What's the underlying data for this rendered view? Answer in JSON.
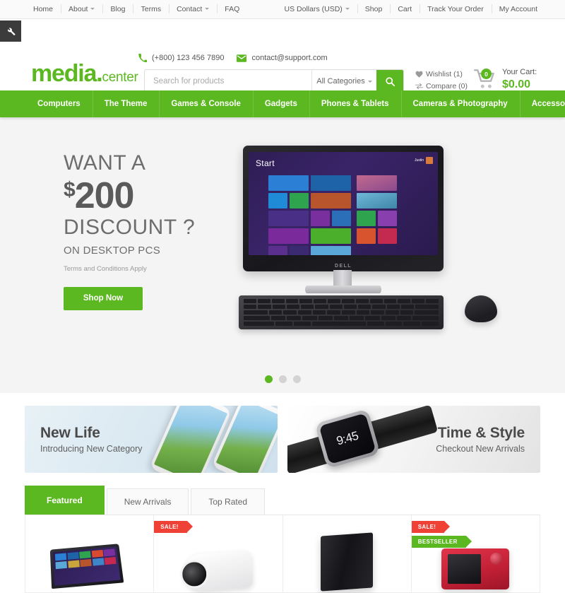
{
  "topbar": {
    "left_links": [
      {
        "label": "Home",
        "caret": false
      },
      {
        "label": "About",
        "caret": true
      },
      {
        "label": "Blog",
        "caret": false
      },
      {
        "label": "Terms",
        "caret": false
      },
      {
        "label": "Contact",
        "caret": true
      },
      {
        "label": "FAQ",
        "caret": false
      }
    ],
    "right_links": [
      {
        "label": "US Dollars (USD)",
        "caret": true
      },
      {
        "label": "Shop",
        "caret": false
      },
      {
        "label": "Cart",
        "caret": false
      },
      {
        "label": "Track Your Order",
        "caret": false
      },
      {
        "label": "My Account",
        "caret": false
      }
    ]
  },
  "header": {
    "wrench_icon": "wrench-icon",
    "phone_icon": "phone-icon",
    "phone": "(+800) 123 456 7890",
    "email_icon": "envelope-icon",
    "email": "contact@support.com",
    "logo_main": "media",
    "logo_dot": ".",
    "logo_sub": "center",
    "search_placeholder": "Search for products",
    "search_value": "",
    "category_selected": "All Categories",
    "search_icon": "search-icon",
    "wishlist_icon": "heart-icon",
    "wishlist_label": "Wishlist (1)",
    "compare_icon": "compare-icon",
    "compare_label": "Compare (0)",
    "cart_icon": "shopping-cart-icon",
    "cart_count": "0",
    "cart_label": "Your Cart:",
    "cart_total": "$0.00"
  },
  "mainnav": {
    "items": [
      {
        "label": "Computers"
      },
      {
        "label": "The Theme"
      },
      {
        "label": "Games & Console"
      },
      {
        "label": "Gadgets"
      },
      {
        "label": "Phones & Tablets"
      },
      {
        "label": "Cameras & Photography"
      },
      {
        "label": "Accessories"
      }
    ]
  },
  "hero": {
    "line1": "WANT A",
    "dollar_sign": "$",
    "amount": "200",
    "line2": "DISCOUNT ?",
    "line3": "ON DESKTOP PCS",
    "terms": "Terms and Conditions Apply",
    "cta": "Shop Now",
    "screen_start": "Start",
    "screen_user": "Justin",
    "monitor_brand": "DELL",
    "dots": [
      {
        "active": true
      },
      {
        "active": false
      },
      {
        "active": false
      }
    ]
  },
  "promos": [
    {
      "title": "New Life",
      "subtitle": "Introducing New Category",
      "art": "smartphones"
    },
    {
      "title": "Time & Style",
      "subtitle": "Checkout New Arrivals",
      "art": "smartwatch",
      "watch_time": "9:45"
    }
  ],
  "product_tabs": [
    {
      "label": "Featured",
      "active": true
    },
    {
      "label": "New Arrivals",
      "active": false
    },
    {
      "label": "Top Rated",
      "active": false
    }
  ],
  "products": [
    {
      "art": "laptop",
      "ribbons": []
    },
    {
      "art": "camcorder",
      "ribbons": [
        {
          "label": "SALE!",
          "type": "sale"
        }
      ]
    },
    {
      "art": "console",
      "ribbons": []
    },
    {
      "art": "redcam",
      "ribbons": [
        {
          "label": "SALE!",
          "type": "sale"
        },
        {
          "label": "BESTSELLER",
          "type": "best"
        }
      ]
    }
  ],
  "colors": {
    "brand_green": "#5cb820",
    "sale_red": "#ef4136",
    "hero_bg": "#f4f4f4",
    "topbar_bg": "#fafafa"
  }
}
